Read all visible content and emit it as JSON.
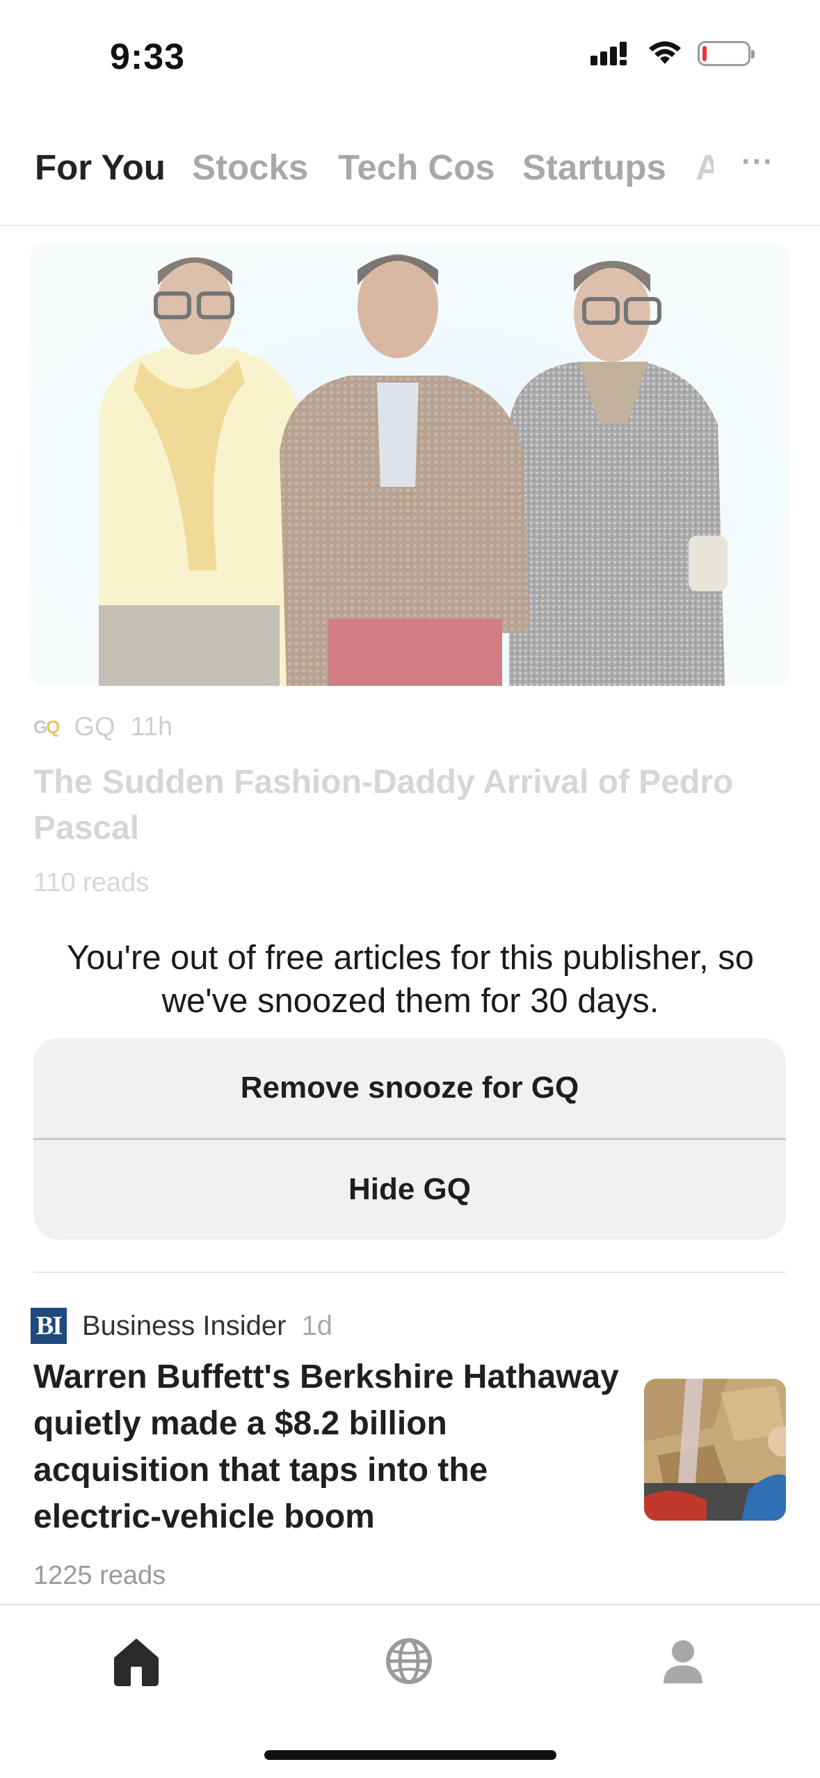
{
  "status_bar": {
    "time": "9:33",
    "icons": [
      "signal-icon",
      "wifi-icon",
      "battery-low-icon"
    ]
  },
  "tabs": [
    {
      "label": "For You",
      "active": true
    },
    {
      "label": "Stocks",
      "active": false
    },
    {
      "label": "Tech Cos",
      "active": false
    },
    {
      "label": "Startups",
      "active": false
    }
  ],
  "tabs_overflow_fragment": "A",
  "more_label": "···",
  "article1": {
    "source": "GQ",
    "time": "11h",
    "title": "The Sudden Fashion-Daddy Arrival of Pedro Pascal",
    "reads": "110 reads"
  },
  "snooze": {
    "message": "You're out of free articles for this publisher, so we've snoozed them for 30 days.",
    "remove_label": "Remove snooze for GQ",
    "hide_label": "Hide GQ"
  },
  "article2": {
    "source_logo": "BI",
    "source": "Business Insider",
    "time": "1d",
    "title": "Warren Buffett's Berkshire Hathaway quietly made a $8.2 billion acquisition that taps into the electric-vehicle boom",
    "reads": "1225 reads"
  },
  "bottom_nav": [
    {
      "icon": "home-icon",
      "active": true
    },
    {
      "icon": "globe-icon",
      "active": false
    },
    {
      "icon": "profile-icon",
      "active": false
    }
  ],
  "colors": {
    "active_text": "#222222",
    "inactive_tab": "#a8a8a8",
    "card_bg": "#f1f1f1",
    "bi_blue": "#1f4a7d",
    "battery_low": "#e53935"
  }
}
